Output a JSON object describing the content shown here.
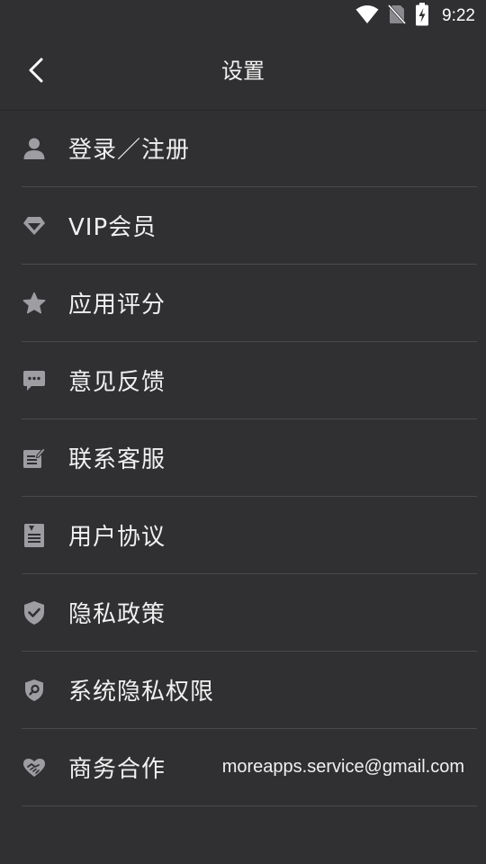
{
  "status_bar": {
    "time": "9:22",
    "icons": [
      "wifi-icon",
      "no-sim-icon",
      "battery-charging-icon"
    ]
  },
  "app_bar": {
    "title": "设置",
    "back_icon": "chevron-left-icon"
  },
  "menu": {
    "items": [
      {
        "label": "登录／注册",
        "icon": "user-icon"
      },
      {
        "label": "VIP会员",
        "icon": "diamond-icon"
      },
      {
        "label": "应用评分",
        "icon": "star-icon"
      },
      {
        "label": "意见反馈",
        "icon": "chat-bubble-icon"
      },
      {
        "label": "联系客服",
        "icon": "edit-note-icon"
      },
      {
        "label": "用户协议",
        "icon": "document-icon"
      },
      {
        "label": "隐私政策",
        "icon": "shield-check-icon"
      },
      {
        "label": "系统隐私权限",
        "icon": "shield-search-icon"
      },
      {
        "label": "商务合作",
        "icon": "handshake-icon",
        "value": "moreapps.service@gmail.com"
      }
    ]
  },
  "colors": {
    "background": "#303033",
    "divider": "#4a4a4e",
    "icon": "#9e9ea2",
    "text": "#f0f0f0"
  }
}
